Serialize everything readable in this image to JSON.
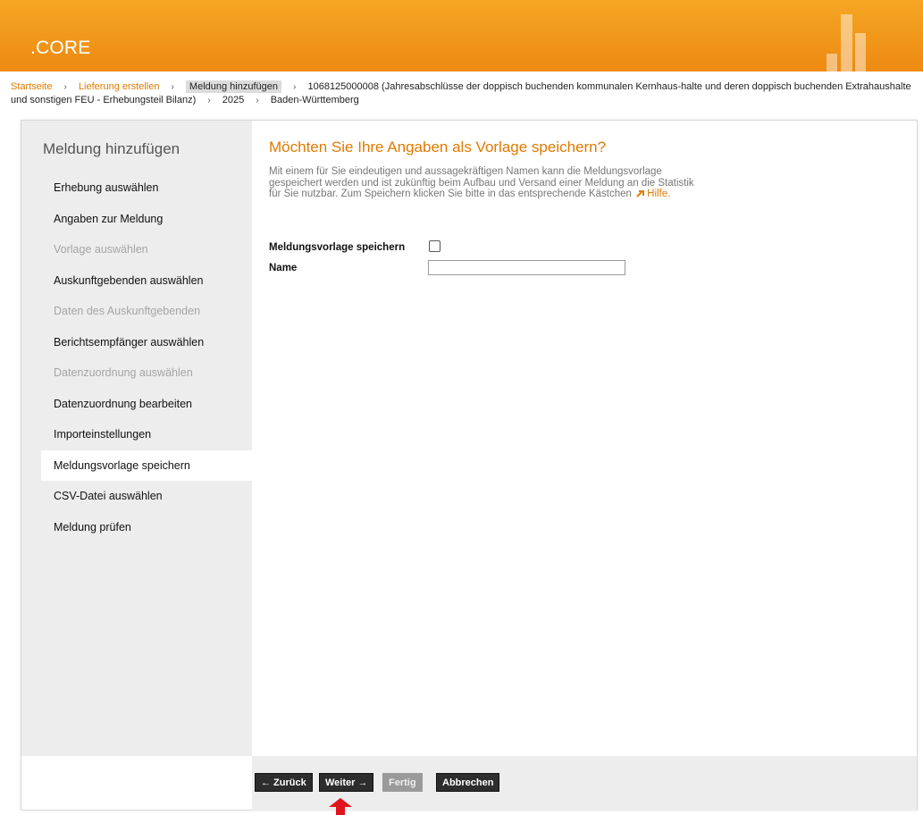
{
  "app": {
    "logo": ".CORE"
  },
  "breadcrumb": {
    "items": [
      "Startseite",
      "Lieferung erstellen",
      "Meldung hinzufügen",
      "1068125000008 (Jahresabschlüsse der doppisch buchenden kommunalen Kernhaus-halte und deren doppisch buchenden Extrahaushalte und sonstigen FEU - Erhebungsteil Bilanz)",
      "2025",
      "Baden-Württemberg"
    ],
    "separator": "›"
  },
  "sidebar": {
    "title": "Meldung hinzufügen",
    "items": [
      {
        "label": "Erhebung auswählen",
        "state": "enabled"
      },
      {
        "label": "Angaben zur Meldung",
        "state": "enabled"
      },
      {
        "label": "Vorlage auswählen",
        "state": "disabled"
      },
      {
        "label": "Auskunftgebenden auswählen",
        "state": "enabled"
      },
      {
        "label": "Daten des Auskunftgebenden",
        "state": "disabled"
      },
      {
        "label": "Berichtsempfänger auswählen",
        "state": "enabled"
      },
      {
        "label": "Datenzuordnung auswählen",
        "state": "disabled"
      },
      {
        "label": "Datenzuordnung bearbeiten",
        "state": "enabled"
      },
      {
        "label": "Importeinstellungen",
        "state": "enabled"
      },
      {
        "label": "Meldungsvorlage speichern",
        "state": "active"
      },
      {
        "label": "CSV-Datei auswählen",
        "state": "enabled"
      },
      {
        "label": "Meldung prüfen",
        "state": "enabled"
      }
    ]
  },
  "main": {
    "title": "Möchten Sie Ihre Angaben als Vorlage speichern?",
    "description": "Mit einem für Sie eindeutigen und aussagekräftigen Namen kann die Meldungsvorlage gespeichert werden und ist zukünftig beim Aufbau und Versand einer Meldung an die Statistik für Sie nutzbar. Zum Speichern klicken Sie bitte in das entsprechende Kästchen",
    "help_link": "Hilfe",
    "save_template_label": "Meldungsvorlage speichern",
    "save_template_checked": false,
    "name_label": "Name",
    "name_value": ""
  },
  "footer": {
    "back": "← Zurück",
    "next": "Weiter →",
    "finish": "Fertig",
    "cancel": "Abbrechen"
  },
  "colors": {
    "header_orange": "#f5a623",
    "accent_orange": "#e07a00",
    "sidebar_bg": "#ededed",
    "button_dark": "#2d2d2d",
    "arrow_red": "#e0141e"
  },
  "icons": {
    "help": "external-link-icon",
    "indicator": "red-arrow-icon"
  }
}
